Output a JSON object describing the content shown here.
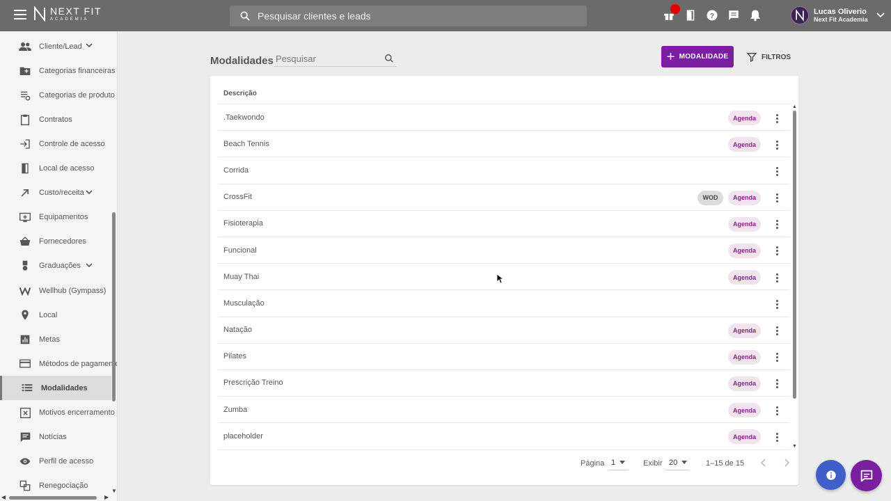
{
  "header": {
    "logo_main": "NEXT FIT",
    "logo_sub": "ACADEMIA",
    "search_placeholder": "Pesquisar clientes e leads",
    "user_name": "Lucas Oliverio",
    "user_company": "Next Fit Academia"
  },
  "sidebar": {
    "items": [
      {
        "label": "Cliente/Lead",
        "icon": "people-icon",
        "chevron": true
      },
      {
        "label": "Categorias financeiras",
        "icon": "folder-plus-icon"
      },
      {
        "label": "Categorias de produto",
        "icon": "stack-settings-icon"
      },
      {
        "label": "Contratos",
        "icon": "clipboard-icon"
      },
      {
        "label": "Controle de acesso",
        "icon": "login-icon"
      },
      {
        "label": "Local de acesso",
        "icon": "door-icon"
      },
      {
        "label": "Custo/receita",
        "icon": "arrow-diagonal-icon",
        "chevron": true
      },
      {
        "label": "Equipamentos",
        "icon": "monitor-plus-icon"
      },
      {
        "label": "Fornecedores",
        "icon": "basket-icon"
      },
      {
        "label": "Graduações",
        "icon": "medal-icon",
        "chevron": true
      },
      {
        "label": "Wellhub (Gympass)",
        "icon": "w-icon"
      },
      {
        "label": "Local",
        "icon": "pin-icon"
      },
      {
        "label": "Metas",
        "icon": "bar-chart-icon"
      },
      {
        "label": "Métodos de pagamento",
        "icon": "card-icon"
      },
      {
        "label": "Modalidades",
        "icon": "list-icon",
        "active": true
      },
      {
        "label": "Motivos encerramento",
        "icon": "x-box-icon"
      },
      {
        "label": "Notícias",
        "icon": "message-icon"
      },
      {
        "label": "Perfil de acesso",
        "icon": "eye-icon"
      },
      {
        "label": "Renegociação",
        "icon": "renegotiate-icon"
      }
    ]
  },
  "page": {
    "title": "Modalidades",
    "search_placeholder": "Pesquisar",
    "add_label": "MODALIDADE",
    "filter_label": "FILTROS",
    "column_header": "Descrição"
  },
  "rows": [
    {
      "name": ".Taekwondo",
      "tags": [
        "Agenda"
      ]
    },
    {
      "name": "Beach Tennis",
      "tags": [
        "Agenda"
      ]
    },
    {
      "name": "Corrida",
      "tags": []
    },
    {
      "name": "CrossFit",
      "tags": [
        "WOD",
        "Agenda"
      ]
    },
    {
      "name": "Fisioterapia",
      "tags": [
        "Agenda"
      ]
    },
    {
      "name": "Funcional",
      "tags": [
        "Agenda"
      ]
    },
    {
      "name": "Muay Thai",
      "tags": [
        "Agenda"
      ]
    },
    {
      "name": "Musculação",
      "tags": []
    },
    {
      "name": "Natação",
      "tags": [
        "Agenda"
      ]
    },
    {
      "name": "Pilates",
      "tags": [
        "Agenda"
      ]
    },
    {
      "name": "Prescrição Treino",
      "tags": [
        "Agenda"
      ]
    },
    {
      "name": "Zumba",
      "tags": [
        "Agenda"
      ]
    },
    {
      "name": "placeholder",
      "tags": [
        "Agenda"
      ]
    }
  ],
  "pagination": {
    "page_label": "Página",
    "page_value": "1",
    "show_label": "Exibir",
    "show_value": "20",
    "range": "1–15 de 15"
  },
  "colors": {
    "accent": "#7a1fa0",
    "topbar": "#6b6b6b",
    "chip_agenda_bg": "#f1e4ee",
    "chip_agenda_text": "#8a1f8a",
    "info_fab": "#3f5fc7"
  }
}
